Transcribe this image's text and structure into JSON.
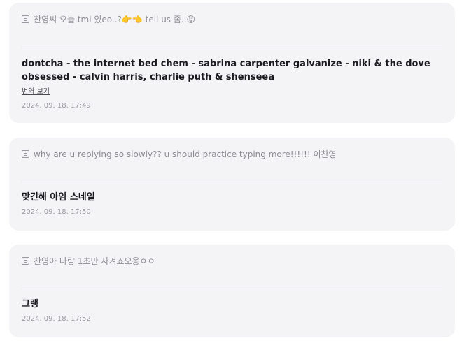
{
  "posts": [
    {
      "question": "찬영씨 오늘 tmi 있eo..?👉👈 tell us 좀..😝",
      "answer": "dontcha - the internet bed chem - sabrina carpenter galvanize - niki & the dove obsessed - calvin harris, charlie puth & shenseea",
      "translate_label": "번역 보기",
      "timestamp": "2024. 09. 18. 17:49"
    },
    {
      "question": "why are u replying so slowly?? u should practice typing more!!!!!! 이찬영",
      "answer": "맞긴해 아임 스네일",
      "timestamp": "2024. 09. 18. 17:50"
    },
    {
      "question": "찬영아 나랑 1초만 사겨죠오옹ㅇㅇ",
      "answer": "그랭",
      "timestamp": "2024. 09. 18. 17:52"
    }
  ]
}
